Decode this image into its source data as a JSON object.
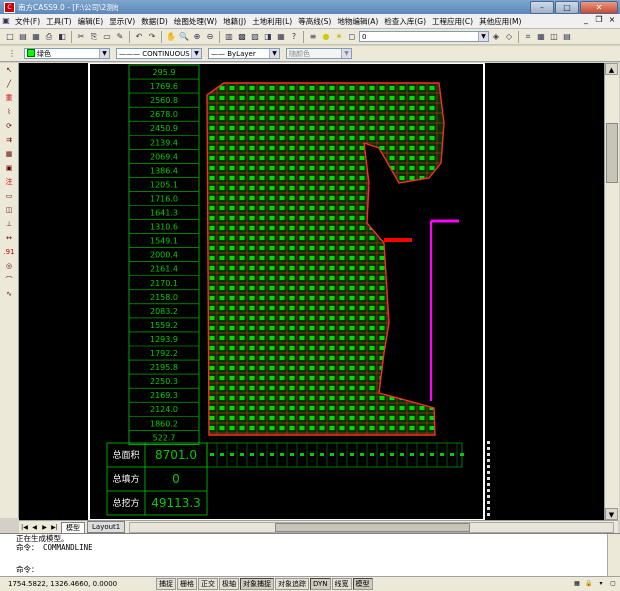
{
  "window": {
    "title": "南方CASS9.0 - [F:\\公司\\2测绘项目\\1工程..."
  },
  "menu": [
    "文件(F)",
    "工具(T)",
    "编辑(E)",
    "显示(V)",
    "数据(D)",
    "绘图处理(W)",
    "地籍(J)",
    "土地利用(L)",
    "等高线(S)",
    "地物编辑(A)",
    "检查入库(G)",
    "工程应用(C)",
    "其他应用(M)"
  ],
  "toolbar1": {
    "layer_value": "0"
  },
  "toolbar2": {
    "color": "绿色",
    "linetype": "CONTINUOUS",
    "lineweight": "ByLayer",
    "plotstyle": "随颜色"
  },
  "left_tools": [
    "重",
    "注",
    ".91"
  ],
  "colors": {
    "canvas": "#000000",
    "table": "#00cc00",
    "grid_line": "#ff2a2a",
    "grid_fill": "#00ff00",
    "boundary": "#ff00ff"
  },
  "volume_table": {
    "values": [
      "295.9",
      "1769.6",
      "2560.8",
      "2678.0",
      "2450.9",
      "2139.4",
      "2069.4",
      "1386.4",
      "1205.1",
      "1716.0",
      "1641.3",
      "1310.6",
      "1549.1",
      "2000.4",
      "2161.4",
      "2170.1",
      "2158.0",
      "2083.2",
      "1559.2",
      "1293.9",
      "1792.2",
      "2195.8",
      "2250.3",
      "2169.3",
      "2124.0",
      "1860.2",
      "522.7"
    ]
  },
  "summary": {
    "area_label": "总面积",
    "area_value": "8701.0",
    "fill_label": "总填方",
    "fill_value": "0",
    "cut_label": "总挖方",
    "cut_value": "49113.3"
  },
  "tabs": {
    "model": "模型",
    "layout": "Layout1"
  },
  "command": {
    "line1": "正在生成模型。",
    "line2": "命令： COMMANDLINE",
    "prompt": "命令："
  },
  "status": {
    "coords": "1754.5822,  1326.4660,  0.0000",
    "buttons": [
      "捕捉",
      "栅格",
      "正交",
      "极轴",
      "对象捕捉",
      "对象追踪",
      "DYN",
      "线宽",
      "模型"
    ]
  }
}
